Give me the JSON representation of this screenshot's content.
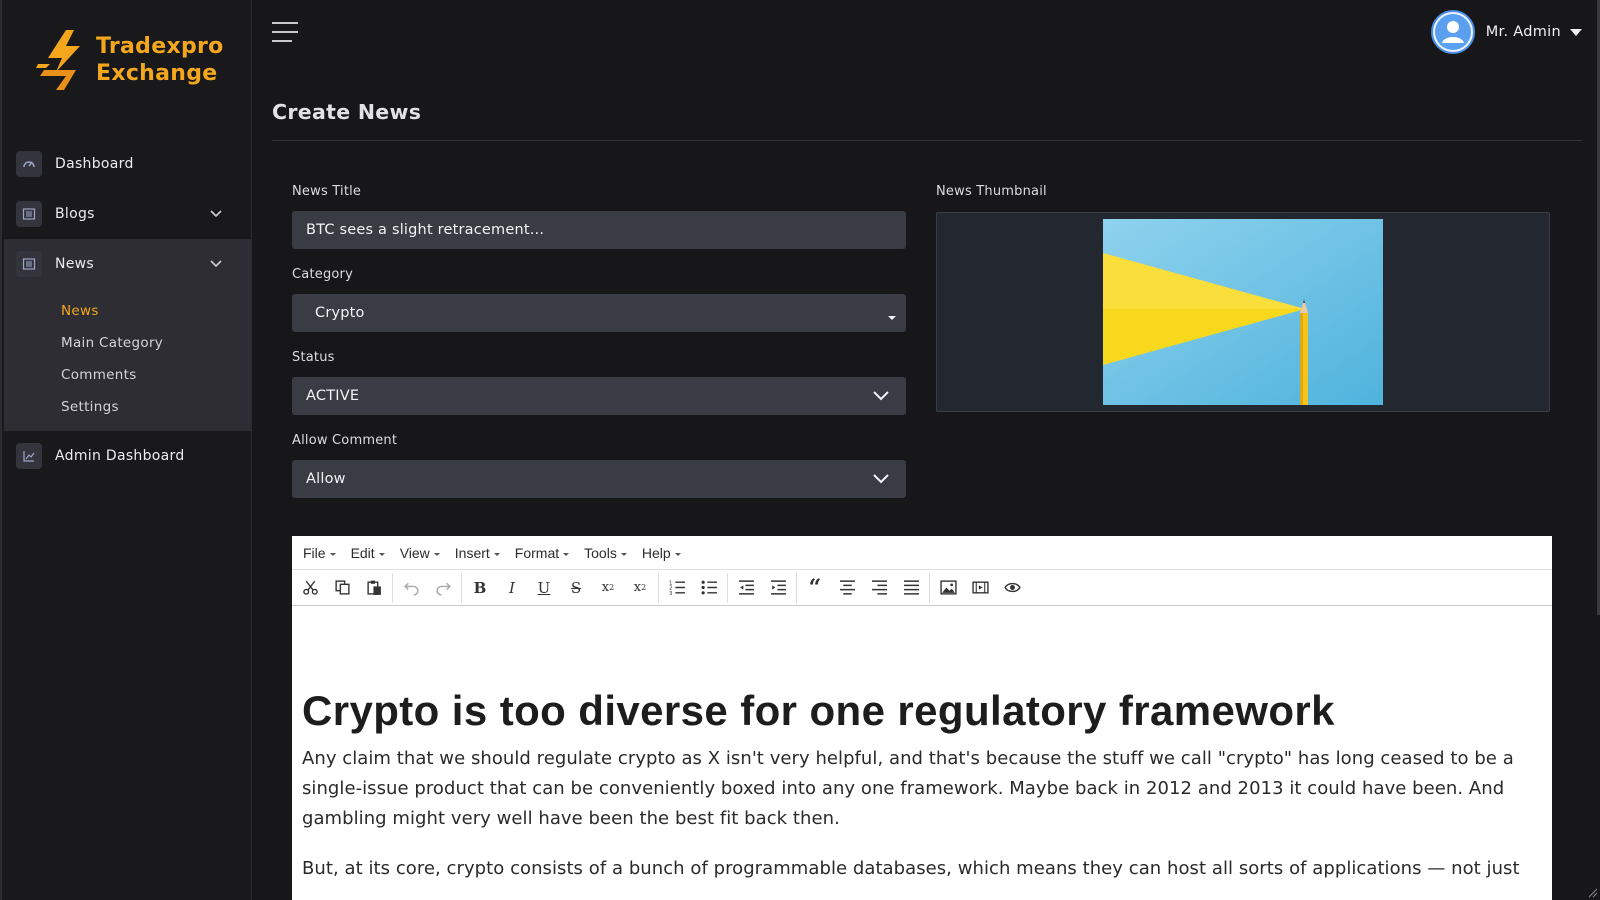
{
  "brand": {
    "line1": "Tradexpro",
    "line2": "Exchange",
    "accent": "#f4a71d"
  },
  "sidebar": {
    "items": [
      {
        "label": "Dashboard",
        "icon": "speedometer-icon"
      },
      {
        "label": "Blogs",
        "icon": "list-icon"
      },
      {
        "label": "News",
        "icon": "list-icon"
      },
      {
        "label": "Admin Dashboard",
        "icon": "chart-icon"
      }
    ],
    "news_sub": [
      "News",
      "Main Category",
      "Comments",
      "Settings"
    ]
  },
  "header": {
    "user_name": "Mr. Admin"
  },
  "page": {
    "title": "Create News"
  },
  "form": {
    "title_label": "News Title",
    "title_value": "BTC sees a slight retracement...",
    "category_label": "Category",
    "category_value": "Crypto",
    "status_label": "Status",
    "status_value": "ACTIVE",
    "comment_label": "Allow Comment",
    "comment_value": "Allow",
    "thumb_label": "News Thumbnail"
  },
  "editor": {
    "menus": [
      "File",
      "Edit",
      "View",
      "Insert",
      "Format",
      "Tools",
      "Help"
    ],
    "heading": "Crypto is too diverse for one regulatory framework",
    "paragraph1": "Any claim that we should regulate crypto as X isn't very helpful, and that's because the stuff we call \"crypto\" has long ceased to be a single-issue product that can be conveniently boxed into any one framework. Maybe back in 2012 and 2013 it could have been. And gambling might very well have been the best fit back then.",
    "paragraph2": "But, at its core, crypto consists of a bunch of programmable databases, which means they can host all sorts of applications — not just"
  }
}
